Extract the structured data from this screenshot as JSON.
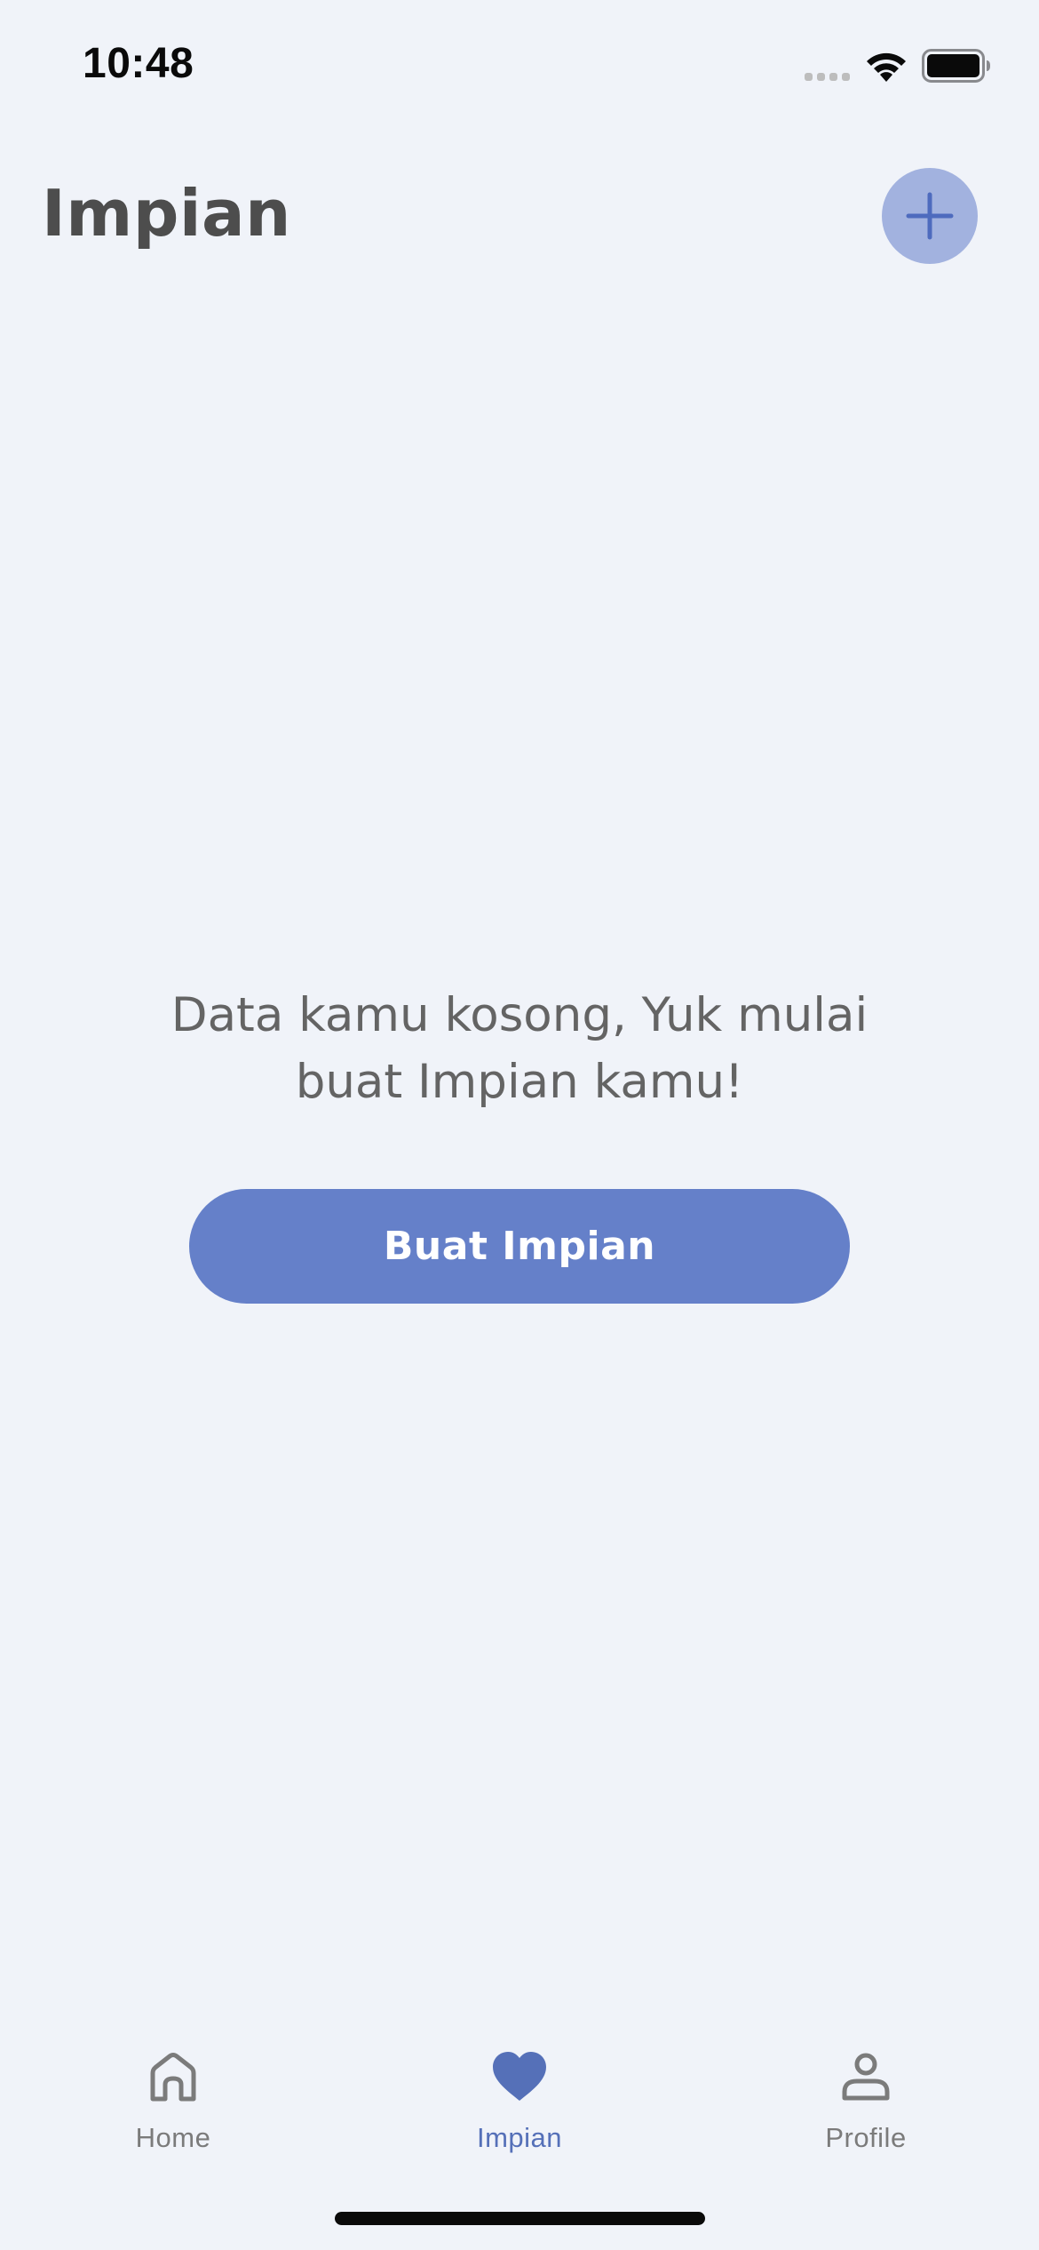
{
  "status_bar": {
    "time": "10:48"
  },
  "header": {
    "title": "Impian",
    "add_icon": "plus-icon"
  },
  "empty_state": {
    "message_line1": "Data kamu kosong, Yuk mulai",
    "message_line2": "buat Impian kamu!",
    "button_label": "Buat Impian"
  },
  "bottom_nav": {
    "items": [
      {
        "label": "Home",
        "icon": "home-icon",
        "active": false
      },
      {
        "label": "Impian",
        "icon": "heart-icon",
        "active": true
      },
      {
        "label": "Profile",
        "icon": "person-icon",
        "active": false
      }
    ]
  },
  "colors": {
    "background": "#F0F3F9",
    "accent": "#6580C9",
    "add_button_bg": "#A2B2DF",
    "active_nav": "#5570B8",
    "inactive_nav": "#7B7B7B",
    "title_text": "#4D4D4D",
    "message_text": "#646464"
  }
}
